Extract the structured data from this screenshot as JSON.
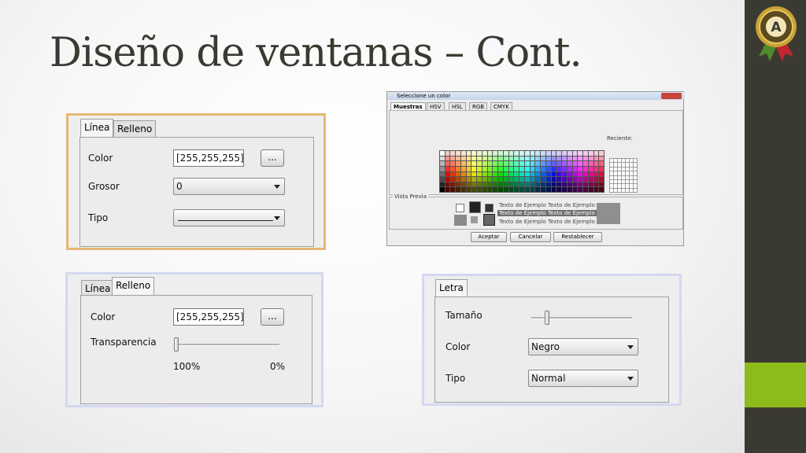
{
  "slide": {
    "title": "Diseño de ventanas – Cont."
  },
  "colors": {
    "sidebar": "#3b3a32",
    "accent": "#8dbb1c",
    "logo_gold": "#c9a235",
    "logo_ribbon_green": "#4f8a2b",
    "logo_ribbon_red": "#c0262d"
  },
  "logo": {
    "icon": "medal-badge-icon",
    "letter": "A"
  },
  "panel_linea": {
    "tabs": [
      {
        "label": "Línea",
        "active": true
      },
      {
        "label": "Relleno",
        "active": false
      }
    ],
    "color_label": "Color",
    "color_value": "[255,255,255]",
    "browse_label": "...",
    "grosor_label": "Grosor",
    "grosor_value": "0",
    "tipo_label": "Tipo"
  },
  "panel_relleno": {
    "tabs": [
      {
        "label": "Línea",
        "active": false
      },
      {
        "label": "Relleno",
        "active": true
      }
    ],
    "color_label": "Color",
    "color_value": "[255,255,255]",
    "browse_label": "...",
    "transparencia_label": "Transparencia",
    "transparencia_value": 0.0,
    "min_label": "100%",
    "max_label": "0%"
  },
  "panel_letra": {
    "tabs": [
      {
        "label": "Letra",
        "active": true
      }
    ],
    "tamano_label": "Tamaño",
    "tamano_value": 0.15,
    "color_label": "Color",
    "color_value": "Negro",
    "tipo_label": "Tipo",
    "tipo_value": "Normal"
  },
  "color_chooser": {
    "window_title": "Seleccione un color",
    "tabs": [
      {
        "label": "Muestras",
        "active": true
      },
      {
        "label": "HSV",
        "active": false
      },
      {
        "label": "HSL",
        "active": false
      },
      {
        "label": "RGB",
        "active": false
      },
      {
        "label": "CMYK",
        "active": false
      }
    ],
    "recent_label": "Reciente:",
    "preview_label": "Vista Previa",
    "sample_text": "Texto de Ejemplo",
    "buttons": {
      "accept": "Aceptar",
      "cancel": "Cancelar",
      "reset": "Restablecer"
    }
  }
}
